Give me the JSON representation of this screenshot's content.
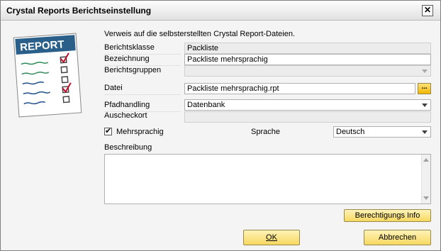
{
  "window": {
    "title": "Crystal Reports Berichtseinstellung",
    "close_glyph": "✕"
  },
  "logo": {
    "text": "REPORT"
  },
  "intro_text": "Verweis auf die selbsterstellten Crystal Report-Dateien.",
  "fields": {
    "berichtsklasse": {
      "label": "Berichtsklasse",
      "value": "Packliste"
    },
    "bezeichnung": {
      "label": "Bezeichnung",
      "value": "Packliste mehrsprachig"
    },
    "berichtsgruppen": {
      "label": "Berichtsgruppen",
      "value": ""
    },
    "datei": {
      "label": "Datei",
      "value": "Packliste mehrsprachig.rpt",
      "browse_label": "..."
    },
    "pfadhandling": {
      "label": "Pfadhandling",
      "value": "Datenbank"
    },
    "ausscheckort": {
      "label": "Auscheckort",
      "value": ""
    }
  },
  "mehrsprachig": {
    "label": "Mehrsprachig",
    "checked": true,
    "check_glyph": "✔"
  },
  "sprache": {
    "label": "Sprache",
    "value": "Deutsch"
  },
  "beschreibung": {
    "label": "Beschreibung",
    "value": ""
  },
  "buttons": {
    "berechtigungs_info": "Berechtigungs Info",
    "ok": "OK",
    "abbrechen": "Abbrechen"
  },
  "colors": {
    "button_top": "#fff3b8",
    "button_bottom": "#f6d860",
    "logo_banner": "#2a5f8a"
  }
}
